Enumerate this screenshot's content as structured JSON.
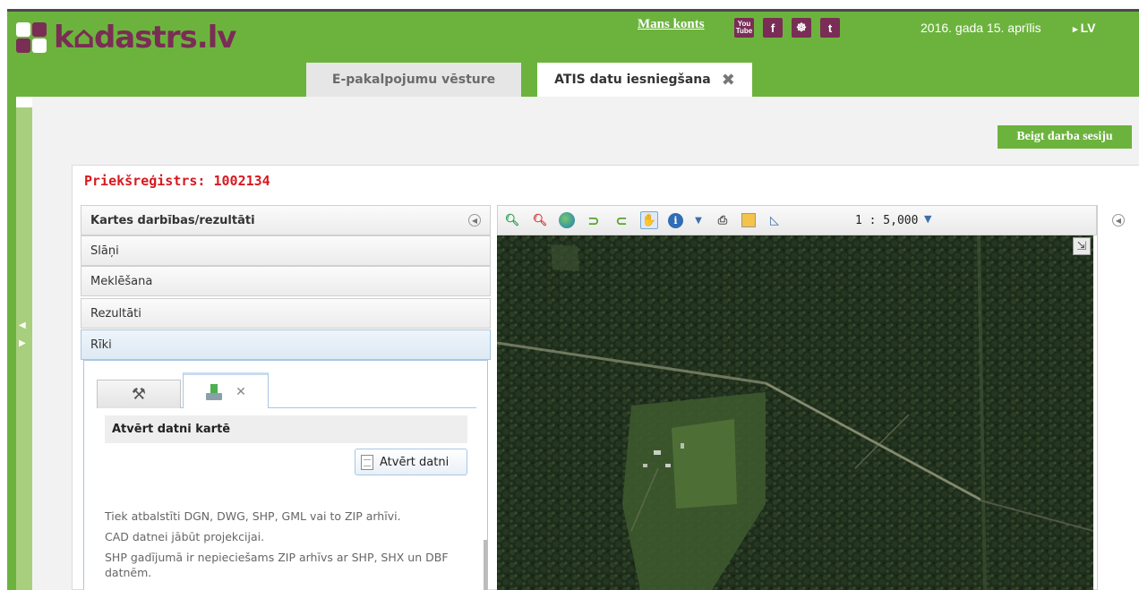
{
  "header": {
    "logo_text": "k⌂dastrs.lv",
    "account_link": "Mans konts",
    "social": [
      {
        "icon": "youtube-icon",
        "glyph": "You Tube"
      },
      {
        "icon": "facebook-icon",
        "glyph": "f"
      },
      {
        "icon": "draugiem-icon",
        "glyph": "☘"
      },
      {
        "icon": "twitter-icon",
        "glyph": "t"
      }
    ],
    "date": "2016. gada 15. aprīlis",
    "language": "LV",
    "tabs": [
      {
        "label": "E-pakalpojumu vēsture",
        "active": false
      },
      {
        "label": "ATIS datu iesniegšana",
        "active": true
      }
    ]
  },
  "colors": {
    "brand_green": "#6cb33e",
    "brand_purple": "#7a2d55",
    "alert_red": "#d71920"
  },
  "end_session_label": "Beigt darba sesiju",
  "preregistry_label": "Priekšreģistrs: 1002134",
  "left_panel": {
    "header": "Kartes darbības/rezultāti",
    "sections": [
      "Slāņi",
      "Meklēšana",
      "Rezultāti",
      "Rīki"
    ],
    "tools": {
      "tabs": [
        {
          "icon": "hammer-wrench-icon"
        },
        {
          "icon": "upload-icon",
          "close_icon": "close-icon"
        }
      ],
      "section_title": "Atvērt datni kartē",
      "open_button": "Atvērt datni",
      "info": [
        "Tiek atbalstīti DGN, DWG, SHP, GML vai to ZIP arhīvi.",
        "CAD datnei jābūt projekcijai.",
        "SHP gadījumā ir nepieciešams ZIP arhīvs ar SHP, SHX un DBF datnēm."
      ]
    }
  },
  "map": {
    "toolbar_icons": [
      "zoom-in-icon",
      "zoom-out-icon",
      "full-extent-icon",
      "back-icon",
      "forward-icon",
      "pan-icon",
      "identify-icon",
      "dropdown-icon",
      "print-icon",
      "legend-icon",
      "measure-icon"
    ],
    "scale": "1 : 5,000"
  }
}
